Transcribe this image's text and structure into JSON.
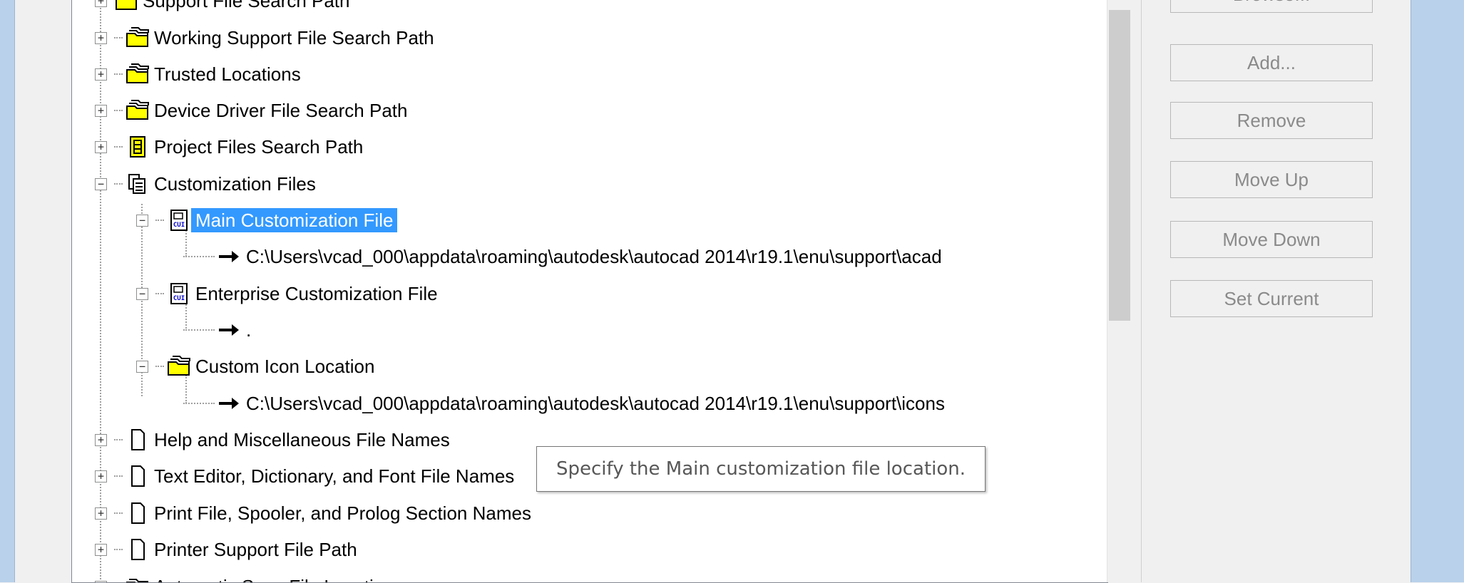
{
  "tree": {
    "items": [
      {
        "label": "Support File Search Path",
        "icon": "folder-stack-icon"
      },
      {
        "label": "Working Support File Search Path",
        "icon": "folder-stack-icon"
      },
      {
        "label": "Trusted Locations",
        "icon": "folder-stack-icon"
      },
      {
        "label": "Device Driver File Search Path",
        "icon": "folder-stack-icon"
      },
      {
        "label": "Project Files Search Path",
        "icon": "project-files-icon"
      },
      {
        "label": "Customization Files",
        "icon": "customization-files-icon"
      },
      {
        "label": "Main Customization File",
        "icon": "cui-file-icon"
      },
      {
        "label": "C:\\Users\\vcad_000\\appdata\\roaming\\autodesk\\autocad 2014\\r19.1\\enu\\support\\acad",
        "icon": "arrow-right-icon"
      },
      {
        "label": "Enterprise Customization File",
        "icon": "cui-file-icon"
      },
      {
        "label": ".",
        "icon": "arrow-right-icon"
      },
      {
        "label": "Custom Icon Location",
        "icon": "folder-stack-icon"
      },
      {
        "label": "C:\\Users\\vcad_000\\appdata\\roaming\\autodesk\\autocad 2014\\r19.1\\enu\\support\\icons",
        "icon": "arrow-right-icon"
      },
      {
        "label": "Help and Miscellaneous File Names",
        "icon": "file-icon"
      },
      {
        "label": "Text Editor, Dictionary, and Font File Names",
        "icon": "file-icon"
      },
      {
        "label": "Print File, Spooler, and Prolog Section Names",
        "icon": "file-icon"
      },
      {
        "label": "Printer Support File Path",
        "icon": "file-icon"
      },
      {
        "label": "Automatic Save File Location",
        "icon": "folder-stack-icon"
      }
    ],
    "selected": "Main Customization File"
  },
  "buttons": {
    "browse": "Browse...",
    "add": "Add...",
    "remove": "Remove",
    "move_up": "Move Up",
    "move_down": "Move Down",
    "set_current": "Set Current"
  },
  "tooltip": "Specify the Main customization file location.",
  "colors": {
    "selection": "#3399ff",
    "folder_yellow": "#ffff00",
    "frame": "#b9d1ea"
  }
}
